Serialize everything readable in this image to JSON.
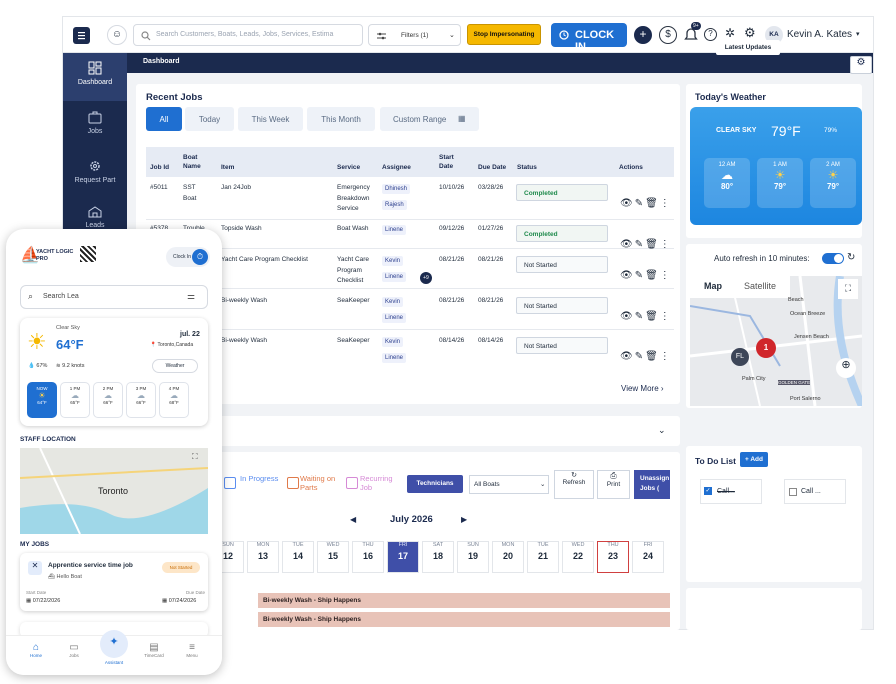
{
  "topbar": {
    "search_placeholder": "Search Customers, Boats, Leads, Jobs, Services, Estima",
    "filters_label": "Filters (1)",
    "impersonate_label": "Stop Impersonating",
    "clock_in_label": "CLOCK IN",
    "notification_count": "9+",
    "user_initials": "KA",
    "user_name": "Kevin A. Kates"
  },
  "sidebar": {
    "items": [
      {
        "label": "Dashboard",
        "icon": "dashboard-icon"
      },
      {
        "label": "Jobs",
        "icon": "jobs-icon"
      },
      {
        "label": "Request Part",
        "icon": "gear-icon"
      },
      {
        "label": "Leads",
        "icon": "leads-icon"
      }
    ]
  },
  "subbar": {
    "title": "Dashboard",
    "latest_updates": "Latest Updates"
  },
  "recent_jobs": {
    "title": "Recent Jobs",
    "tabs": [
      "All",
      "Today",
      "This Week",
      "This Month",
      "Custom Range"
    ],
    "columns": [
      "Job Id",
      "Boat Name",
      "Item",
      "Service",
      "Assignee",
      "Start Date",
      "Due Date",
      "Status",
      "Actions"
    ],
    "rows": [
      {
        "id": "#5011",
        "boat": "SST Boat",
        "item": "Jan 24Job",
        "service": "Emergency Breakdown Service",
        "assignees": [
          "Dhinesh",
          "Rajesh"
        ],
        "start": "10/10/26",
        "due": "03/28/26",
        "status": "Completed"
      },
      {
        "id": "#5378",
        "boat": "Trouble",
        "item": "Topside Wash",
        "service": "Boat Wash",
        "assignees": [
          "Linene"
        ],
        "start": "09/12/26",
        "due": "01/27/26",
        "status": "Completed"
      },
      {
        "id": "",
        "boat": "",
        "item": "Yacht Care Program Checklist",
        "service": "Yacht Care Program Checklist",
        "assignees": [
          "Kevin",
          "Linene"
        ],
        "extra": "+9",
        "start": "08/21/26",
        "due": "08/21/26",
        "status": "Not Started"
      },
      {
        "id": "",
        "boat": "",
        "item": "Bi-weekly Wash",
        "service": "SeaKeeper",
        "assignees": [
          "Kevin",
          "Linene"
        ],
        "start": "08/21/26",
        "due": "08/21/26",
        "status": "Not Started"
      },
      {
        "id": "",
        "boat": "",
        "item": "Bi-weekly Wash",
        "service": "SeaKeeper",
        "assignees": [
          "Kevin",
          "Linene"
        ],
        "start": "08/14/26",
        "due": "08/14/26",
        "status": "Not Started"
      }
    ],
    "view_more": "View More"
  },
  "weather": {
    "title": "Today's Weather",
    "condition": "CLEAR SKY",
    "temp": "79°F",
    "humidity": "79%",
    "hours": [
      {
        "time": "12 AM",
        "temp": "80°"
      },
      {
        "time": "1 AM",
        "temp": "79°"
      },
      {
        "time": "2 AM",
        "temp": "79°"
      }
    ],
    "auto_refresh": "Auto refresh in 10 minutes:"
  },
  "map": {
    "tabs": [
      "Map",
      "Satellite"
    ],
    "labels": [
      "Beach",
      "Ocean Breeze",
      "Jensen Beach",
      "Palm City",
      "Port Salerno",
      "GOLDEN GATE"
    ],
    "pins": [
      "FL",
      "1"
    ]
  },
  "schedule": {
    "filters": [
      "In Progress",
      "Waiting on Parts",
      "Recurring Job"
    ],
    "technicians": "Technicians",
    "boats_select": "All Boats",
    "refresh": "Refresh",
    "print": "Print",
    "unassigned": "Unassign Jobs (",
    "month": "July 2026",
    "days": [
      {
        "dow": "SUN",
        "num": "12"
      },
      {
        "dow": "MON",
        "num": "13"
      },
      {
        "dow": "TUE",
        "num": "14"
      },
      {
        "dow": "WED",
        "num": "15"
      },
      {
        "dow": "THU",
        "num": "16"
      },
      {
        "dow": "FRI",
        "num": "17"
      },
      {
        "dow": "SAT",
        "num": "18"
      },
      {
        "dow": "SUN",
        "num": "19"
      },
      {
        "dow": "MON",
        "num": "20"
      },
      {
        "dow": "TUE",
        "num": "21"
      },
      {
        "dow": "WED",
        "num": "22"
      },
      {
        "dow": "THU",
        "num": "23"
      },
      {
        "dow": "FRI",
        "num": "24"
      }
    ],
    "events": [
      "Bi-weekly Wash - Ship Happens",
      "Bi-weekly Wash - Ship Happens"
    ]
  },
  "todo": {
    "title": "To Do List",
    "add": "+ Add",
    "items": [
      "Call...",
      "Call ..."
    ]
  },
  "phone": {
    "logo": "YACHT LOGIC PRO",
    "clock_in": "Clock In",
    "search_value": "Search Lea",
    "condition": "Clear Sky",
    "temp": "64°F",
    "date": "jul. 22",
    "location": "Toronto,Canada",
    "humidity": "67%",
    "wind": "9.2 knots",
    "weather_btn": "Weather",
    "hours": [
      {
        "time": "NOW",
        "temp": "64°F"
      },
      {
        "time": "1 PM",
        "temp": "65°F"
      },
      {
        "time": "2 PM",
        "temp": "66°F"
      },
      {
        "time": "3 PM",
        "temp": "66°F"
      },
      {
        "time": "4 PM",
        "temp": "68°F"
      }
    ],
    "staff_location": "STAFF LOCATION",
    "map_city": "Toronto",
    "my_jobs": "MY JOBS",
    "job_title": "Apprentice service time job",
    "job_status": "Not Started",
    "job_boat": "Hello Boat",
    "start_label": "Start Date",
    "start_date": "07/22/2026",
    "due_label": "Due Date",
    "due_date": "07/24/2026",
    "nav": [
      "Home",
      "Jobs",
      "Assistant",
      "TimeCard",
      "Menu"
    ]
  }
}
